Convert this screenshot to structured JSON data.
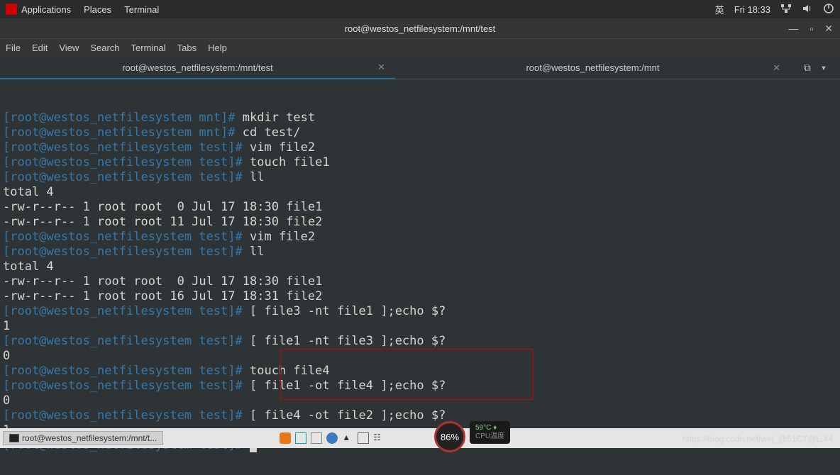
{
  "topbar": {
    "apps": "Applications",
    "places": "Places",
    "terminal": "Terminal",
    "lang": "英",
    "clock": "Fri 18:33"
  },
  "window": {
    "title": "root@westos_netfilesystem:/mnt/test"
  },
  "menubar": [
    "File",
    "Edit",
    "View",
    "Search",
    "Terminal",
    "Tabs",
    "Help"
  ],
  "tabs": [
    {
      "label": "root@westos_netfilesystem:/mnt/test",
      "active": true
    },
    {
      "label": "root@westos_netfilesystem:/mnt",
      "active": false
    }
  ],
  "terminal_lines": [
    {
      "prompt": "[root@westos_netfilesystem mnt]#",
      "cmd": " mkdir test"
    },
    {
      "prompt": "[root@westos_netfilesystem mnt]#",
      "cmd": " cd test/"
    },
    {
      "prompt": "[root@westos_netfilesystem test]#",
      "cmd": " vim file2"
    },
    {
      "prompt": "[root@westos_netfilesystem test]#",
      "cmd": " touch file1"
    },
    {
      "prompt": "[root@westos_netfilesystem test]#",
      "cmd": " ll"
    },
    {
      "plain": "total 4"
    },
    {
      "plain": "-rw-r--r-- 1 root root  0 Jul 17 18:30 file1"
    },
    {
      "plain": "-rw-r--r-- 1 root root 11 Jul 17 18:30 file2"
    },
    {
      "prompt": "[root@westos_netfilesystem test]#",
      "cmd": " vim file2"
    },
    {
      "prompt": "[root@westos_netfilesystem test]#",
      "cmd": " ll"
    },
    {
      "plain": "total 4"
    },
    {
      "plain": "-rw-r--r-- 1 root root  0 Jul 17 18:30 file1"
    },
    {
      "plain": "-rw-r--r-- 1 root root 16 Jul 17 18:31 file2"
    },
    {
      "prompt": "[root@westos_netfilesystem test]#",
      "cmd": " [ file3 -nt file1 ];echo $?"
    },
    {
      "plain": "1"
    },
    {
      "prompt": "[root@westos_netfilesystem test]#",
      "cmd": " [ file1 -nt file3 ];echo $?"
    },
    {
      "plain": "0"
    },
    {
      "prompt": "[root@westos_netfilesystem test]#",
      "cmd": " touch file4"
    },
    {
      "prompt": "[root@westos_netfilesystem test]#",
      "cmd": " [ file1 -ot file4 ];echo $?"
    },
    {
      "plain": "0"
    },
    {
      "prompt": "[root@westos_netfilesystem test]#",
      "cmd": " [ file4 -ot file2 ];echo $?"
    },
    {
      "plain": "1"
    },
    {
      "prompt": "[root@westos_netfilesystem test]#",
      "cursor": true
    }
  ],
  "taskbar": {
    "app_label": "root@westos_netfilesystem:/mnt/t..."
  },
  "gauge": "86%",
  "temp": "59°C",
  "templabel": "CPU温度",
  "watermark": "https://blog.csdn.net/wei_@51CT@L.44"
}
